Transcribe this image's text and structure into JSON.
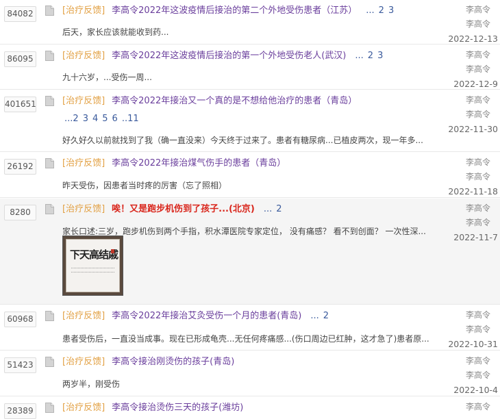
{
  "threads": [
    {
      "count": "84082",
      "category": "[治疗反馈]",
      "title": "李高令2022年这波疫情后接治的第二个外地受伤患者（江苏）",
      "pages_prefix": "...",
      "pages": [
        "2",
        "3"
      ],
      "summary": "后天，家长应该就能收到药...",
      "author1": "李高令",
      "author2": "李高令",
      "date": "2022-12-13"
    },
    {
      "count": "86095",
      "category": "[治疗反馈]",
      "title": "李高令2022年这波疫情后接治的第一个外地受伤老人(武汉)",
      "pages_prefix": "...",
      "pages": [
        "2",
        "3"
      ],
      "summary": "九十六岁，...受伤一周...",
      "author1": "李高令",
      "author2": "李高令",
      "date": "2022-12-9"
    },
    {
      "count": "401651",
      "category": "[治疗反馈]",
      "title": "李高令2022年接治又一个真的是不想给他治疗的患者（青岛）",
      "pages_prefix": "...",
      "pages": [
        "2",
        "3",
        "4",
        "5",
        "6",
        "..11"
      ],
      "summary": "好久好久以前就找到了我（确一直没来）今天终于过来了。患者有糖尿病...已植皮两次，现一年多...",
      "author1": "李高令",
      "author2": "李高令",
      "date": "2022-11-30"
    },
    {
      "count": "26192",
      "category": "[治疗反馈]",
      "title": "李高令2022年接治煤气伤手的患者（青岛）",
      "summary": "昨天受伤，因患者当时疼的厉害（忘了照相）",
      "author1": "李高令",
      "author2": "李高令",
      "date": "2022-11-18"
    },
    {
      "count": "8280",
      "category": "[治疗反馈]",
      "title": "唉！又是跑步机伤到了孩子...(北京)",
      "pages_prefix": "...",
      "pages": [
        "2"
      ],
      "summary": "家长口述:三岁，跑步机伤到两个手指，积水潭医院专家定位， 没有痛感？ 看不到创面？ 一次性深...",
      "thumb_text": "下天高结戚",
      "author1": "李高令",
      "author2": "李高令",
      "date": "2022-11-7"
    },
    {
      "count": "60968",
      "category": "[治疗反馈]",
      "title": "李高令2022年接治艾灸受伤一个月的患者(青岛)",
      "pages_prefix": "...",
      "pages": [
        "2"
      ],
      "summary": "患者受伤后，一直没当成事。现在已形成龟壳...无任何疼痛感...(伤口周边已红肿，这才急了)患者原...",
      "author1": "李高令",
      "author2": "李高令",
      "date": "2022-10-31"
    },
    {
      "count": "51423",
      "category": "[治疗反馈]",
      "title": "李高令接治刚烫伤的孩子(青岛)",
      "summary": "两岁半，刚受伤",
      "author1": "李高令",
      "author2": "李高令",
      "date": "2022-10-4"
    },
    {
      "count": "28389",
      "category": "[治疗反馈]",
      "title": "李高令接治烫伤三天的孩子(潍坊)",
      "author1": "李高令"
    }
  ]
}
